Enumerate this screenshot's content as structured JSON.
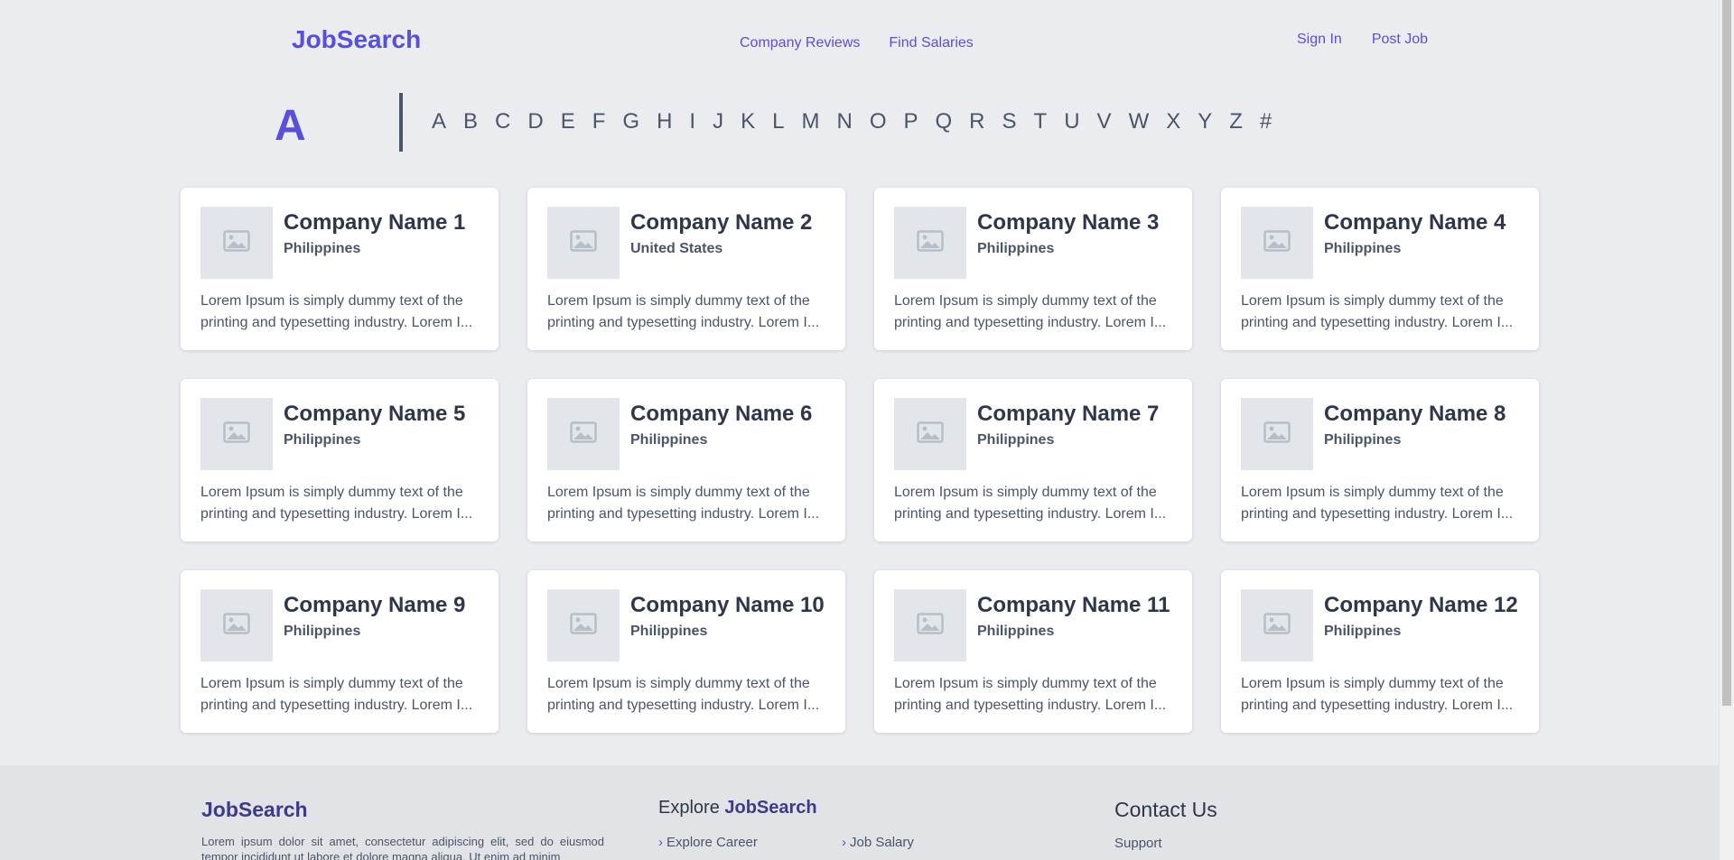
{
  "header": {
    "logo": "JobSearch",
    "nav_center": [
      "Company Reviews",
      "Find Salaries"
    ],
    "nav_right": [
      "Sign In",
      "Post Job"
    ]
  },
  "alphabet": {
    "current": "A",
    "letters": [
      "A",
      "B",
      "C",
      "D",
      "E",
      "F",
      "G",
      "H",
      "I",
      "J",
      "K",
      "L",
      "M",
      "N",
      "O",
      "P",
      "Q",
      "R",
      "S",
      "T",
      "U",
      "V",
      "W",
      "X",
      "Y",
      "Z",
      "#"
    ]
  },
  "companies": [
    {
      "name": "Company Name 1",
      "country": "Philippines"
    },
    {
      "name": "Company Name 2",
      "country": "United States"
    },
    {
      "name": "Company Name 3",
      "country": "Philippines"
    },
    {
      "name": "Company Name 4",
      "country": "Philippines"
    },
    {
      "name": "Company Name 5",
      "country": "Philippines"
    },
    {
      "name": "Company Name 6",
      "country": "Philippines"
    },
    {
      "name": "Company Name 7",
      "country": "Philippines"
    },
    {
      "name": "Company Name 8",
      "country": "Philippines"
    },
    {
      "name": "Company Name 9",
      "country": "Philippines"
    },
    {
      "name": "Company Name 10",
      "country": "Philippines"
    },
    {
      "name": "Company Name 11",
      "country": "Philippines"
    },
    {
      "name": "Company Name 12",
      "country": "Philippines"
    }
  ],
  "card_desc_line1": "Lorem Ipsum is simply dummy text of the",
  "card_desc_line2": "printing and typesetting industry. Lorem I...",
  "footer": {
    "logo": "JobSearch",
    "text": "Lorem ipsum dolor sit amet, consectetur adipiscing elit, sed do eiusmod tempor incididunt ut labore et dolore magna aliqua. Ut enim ad minim",
    "explore_prefix": "Explore",
    "explore_brand": "JobSearch",
    "links": [
      "Explore Career",
      "Job Salary"
    ],
    "contact_title": "Contact Us",
    "contact_links": [
      "Support"
    ]
  },
  "colors": {
    "accent": "#5a4fd6",
    "background": "#ebecf0",
    "footer_bg": "#e2e3e7",
    "card_bg": "#ffffff",
    "placeholder_bg": "#e2e6ea"
  }
}
